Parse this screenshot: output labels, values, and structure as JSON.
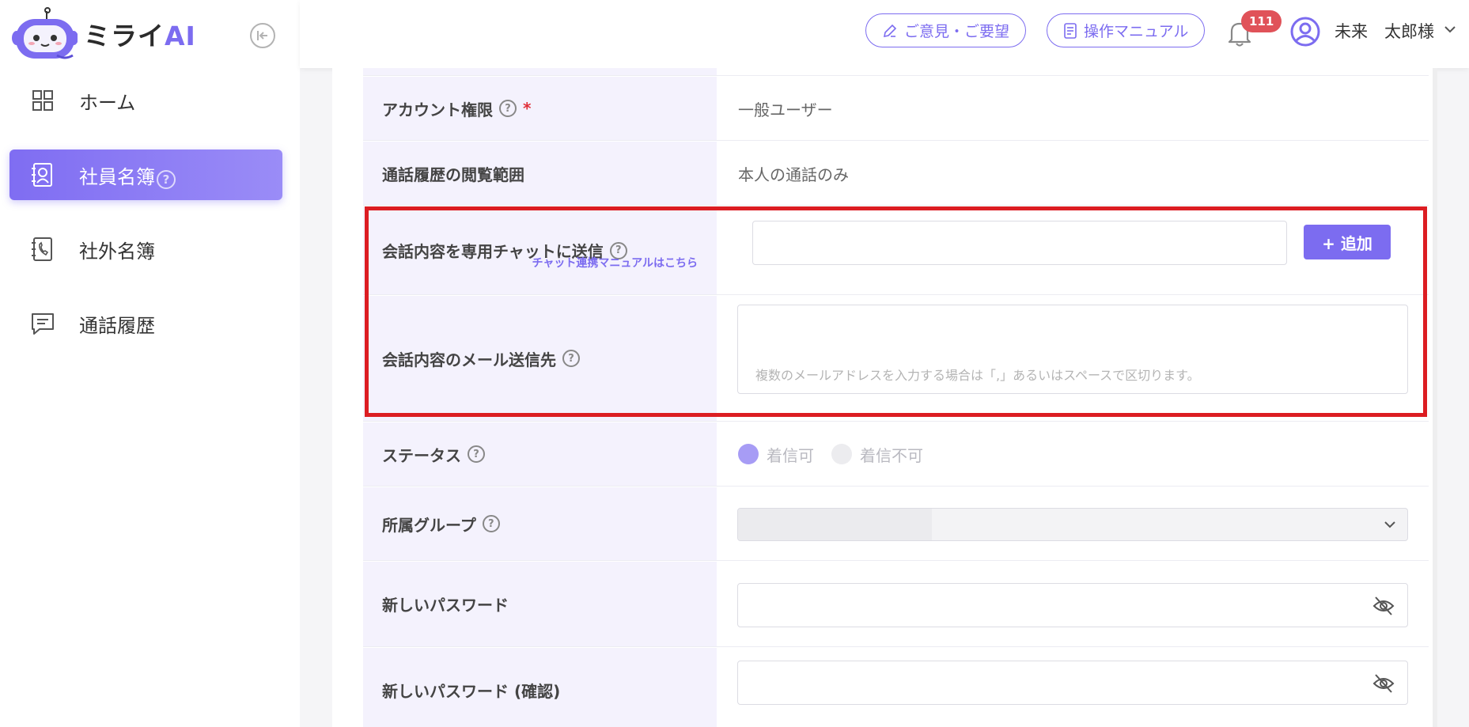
{
  "app": {
    "logo_text": "ミライ",
    "logo_ai": "AI"
  },
  "sidebar": {
    "items": [
      {
        "label": "ホーム",
        "icon": "grid-icon"
      },
      {
        "label": "社員名簿",
        "icon": "address-book-icon",
        "active": true
      },
      {
        "label": "社外名簿",
        "icon": "phone-book-icon"
      },
      {
        "label": "通話履歴",
        "icon": "message-icon"
      }
    ],
    "help_mark": "?"
  },
  "topbar": {
    "feedback_label": "ご意見・ご要望",
    "manual_label": "操作マニュアル",
    "notification_count": "111",
    "user_name": "未来　太郎様"
  },
  "form": {
    "help_mark": "?",
    "required_mark": "*",
    "account_role": {
      "label": "アカウント権限",
      "value": "一般ユーザー"
    },
    "call_history_scope": {
      "label": "通話履歴の閲覧範囲",
      "value": "本人の通話のみ"
    },
    "chat_send": {
      "label": "会話内容を専用チャットに送信",
      "sub_link": "チャット連携マニュアルはこちら",
      "input_value": "",
      "add_button": "+ 追加"
    },
    "mail_send": {
      "label": "会話内容のメール送信先",
      "placeholder": "複数のメールアドレスを入力する場合は「,」あるいはスペースで区切ります。"
    },
    "status": {
      "label": "ステータス",
      "options": [
        "着信可",
        "着信不可"
      ],
      "selected": "着信可"
    },
    "group": {
      "label": "所属グループ",
      "value": ""
    },
    "new_password": {
      "label": "新しいパスワード",
      "value": ""
    },
    "new_password_confirm": {
      "label": "新しいパスワード (確認)",
      "value": ""
    }
  },
  "colors": {
    "accent": "#7c6cf0",
    "highlight_border": "#dc1d22",
    "badge": "#e05259",
    "label_bg": "#f4f2fd"
  }
}
